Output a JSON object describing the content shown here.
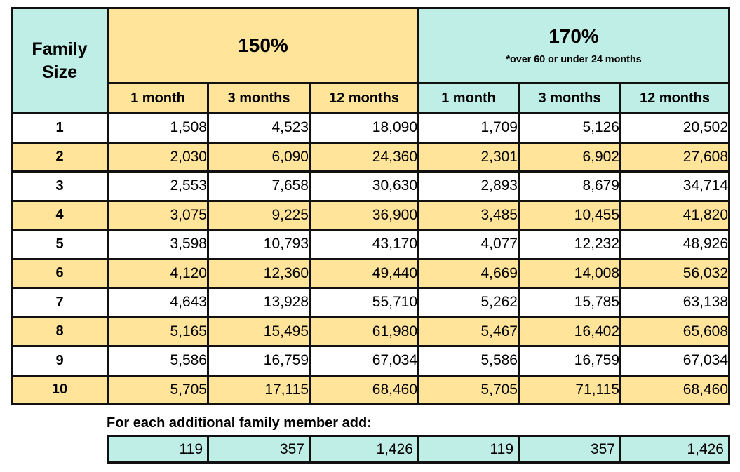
{
  "table": {
    "corner_header": "Family\nSize",
    "corner_header_line1": "Family",
    "corner_header_line2": "Size",
    "groups": [
      {
        "title": "150%",
        "note": "",
        "accent": "#ffe49a"
      },
      {
        "title": "170%",
        "note": "*over 60 or under 24 months",
        "accent": "#bfeee6"
      }
    ],
    "subheaders": [
      "1 month",
      "3 months",
      "12 months",
      "1 month",
      "3 months",
      "12 months"
    ],
    "rows": [
      {
        "family_size": "1",
        "values": [
          "1,508",
          "4,523",
          "18,090",
          "1,709",
          "5,126",
          "20,502"
        ]
      },
      {
        "family_size": "2",
        "values": [
          "2,030",
          "6,090",
          "24,360",
          "2,301",
          "6,902",
          "27,608"
        ]
      },
      {
        "family_size": "3",
        "values": [
          "2,553",
          "7,658",
          "30,630",
          "2,893",
          "8,679",
          "34,714"
        ]
      },
      {
        "family_size": "4",
        "values": [
          "3,075",
          "9,225",
          "36,900",
          "3,485",
          "10,455",
          "41,820"
        ]
      },
      {
        "family_size": "5",
        "values": [
          "3,598",
          "10,793",
          "43,170",
          "4,077",
          "12,232",
          "48,926"
        ]
      },
      {
        "family_size": "6",
        "values": [
          "4,120",
          "12,360",
          "49,440",
          "4,669",
          "14,008",
          "56,032"
        ]
      },
      {
        "family_size": "7",
        "values": [
          "4,643",
          "13,928",
          "55,710",
          "5,262",
          "15,785",
          "63,138"
        ]
      },
      {
        "family_size": "8",
        "values": [
          "5,165",
          "15,495",
          "61,980",
          "5,467",
          "16,402",
          "65,608"
        ]
      },
      {
        "family_size": "9",
        "values": [
          "5,586",
          "16,759",
          "67,034",
          "5,586",
          "16,759",
          "67,034"
        ]
      },
      {
        "family_size": "10",
        "values": [
          "5,705",
          "17,115",
          "68,460",
          "5,705",
          "71,115",
          "68,460"
        ]
      }
    ]
  },
  "footer": {
    "label": "For each additional family member add:",
    "values": [
      "119",
      "357",
      "1,426",
      "119",
      "357",
      "1,426"
    ]
  },
  "colors": {
    "yellow": "#ffe49a",
    "teal": "#bfeee6",
    "border": "#111111",
    "white": "#ffffff"
  }
}
